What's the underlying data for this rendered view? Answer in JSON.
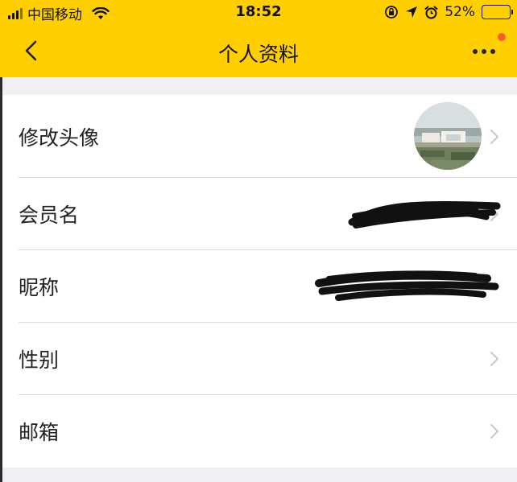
{
  "status_bar": {
    "carrier": "中国移动",
    "time": "18:52",
    "battery_text": "52%",
    "battery_level": 0.52,
    "icons": [
      "signal-icon",
      "wifi-icon",
      "rotation-lock-icon",
      "location-arrow-icon",
      "alarm-icon",
      "battery-icon"
    ]
  },
  "nav": {
    "title": "个人资料",
    "back_icon": "chevron-left-icon",
    "more_icon": "more-dots-icon",
    "has_notification_dot": true
  },
  "rows": [
    {
      "label": "修改头像",
      "value": "avatar-image",
      "chevron": true
    },
    {
      "label": "会员名",
      "value": "",
      "redacted": true,
      "chevron": true
    },
    {
      "label": "昵称",
      "value": "",
      "redacted": true,
      "chevron": false
    },
    {
      "label": "性别",
      "value": "",
      "chevron": true
    },
    {
      "label": "邮箱",
      "value": "",
      "chevron": true
    }
  ],
  "colors": {
    "brand_yellow": "#ffcf00",
    "notification_red": "#ff5a2c",
    "background": "#efeff4",
    "chevron_gray": "#c7c7cc"
  }
}
